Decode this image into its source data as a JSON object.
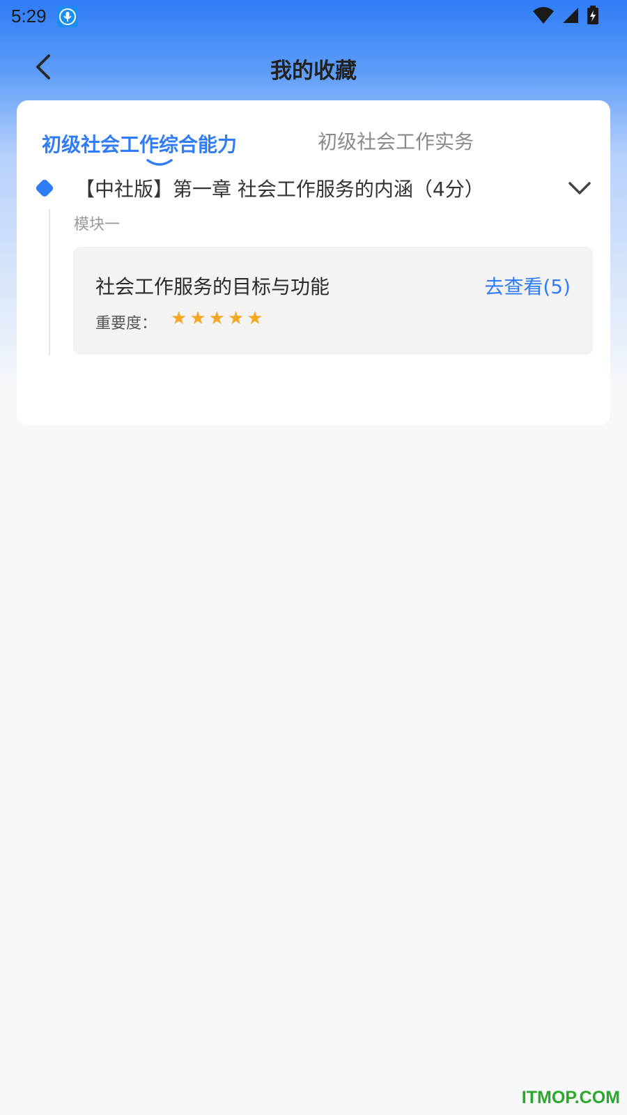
{
  "status_bar": {
    "time": "5:29"
  },
  "header": {
    "title": "我的收藏"
  },
  "tabs": [
    {
      "label": "初级社会工作综合能力",
      "active": true
    },
    {
      "label": "初级社会工作实务",
      "active": false
    }
  ],
  "chapter": {
    "title": "【中社版】第一章 社会工作服务的内涵（4分）",
    "module_label": "模块一",
    "items": [
      {
        "title": "社会工作服务的目标与功能",
        "link": "去查看(5)",
        "importance_label": "重要度：",
        "stars": 5
      }
    ]
  },
  "watermark": "ITMOP.COM",
  "colors": {
    "accent": "#2f7cf6",
    "star": "#f5a623",
    "watermark": "#2aa82a"
  }
}
